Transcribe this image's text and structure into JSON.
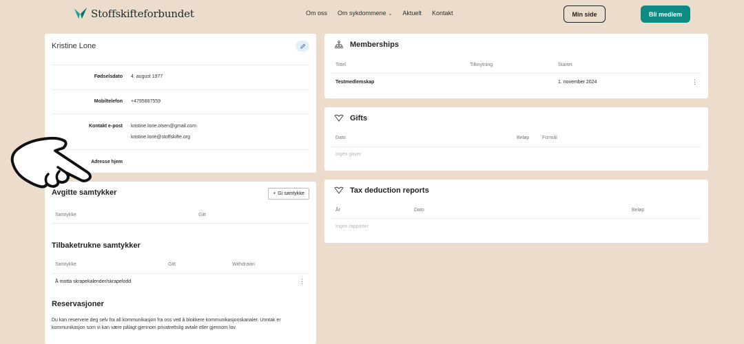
{
  "header": {
    "logo_text": "Stoffskifteforbundet",
    "nav": [
      "Om oss",
      "Om sykdommene",
      "Aktuelt",
      "Kontakt"
    ],
    "min_side": "Min side",
    "bli_medlem": "Bli medlem",
    "accent": "#0f8a82"
  },
  "profile": {
    "name": "Kristine Lone",
    "fields": {
      "birth_label": "Fødselsdato",
      "birth_value": "4. august 1977",
      "phone_label": "Mobiltelefon",
      "phone_value": "+4795887559",
      "email_label": "Kontakt e-post",
      "email_value_1": "kristine.lone.olsen@gmail.com",
      "email_value_2": "kristine.lone@stoffskifte.org",
      "address_label": "Adresse hjem"
    }
  },
  "consents": {
    "given_title": "Avgitte samtykker",
    "give_button": "Gi samtykke",
    "given_cols": [
      "Samtykke",
      "Gitt"
    ],
    "withdrawn_title": "Tilbaketrukne samtykker",
    "withdrawn_cols": [
      "Samtykke",
      "Gitt",
      "Withdrawn"
    ],
    "withdrawn_row": "Å motta skrapekalender/skrapelodd",
    "reservations_title": "Reservasjoner",
    "reservations_text": "Du kan reservere deg selv fra all kommunikasjon fra oss ved å blokkere kommunikasjonskanaler. Unntak er kommunikasjon som vi kan være pålagt gjennom privatrettslig avtale eller gjennom lov."
  },
  "memberships": {
    "title": "Memberships",
    "cols": [
      "Tittel",
      "Tilknytning",
      "Startet"
    ],
    "row_title": "Testmedlemskap",
    "row_start": "1. november 2024"
  },
  "gifts": {
    "title": "Gifts",
    "cols": [
      "Dato",
      "Beløp",
      "Formål"
    ],
    "empty": "Ingen gaver"
  },
  "tax": {
    "title": "Tax deduction reports",
    "cols": [
      "År",
      "Dato",
      "Beløp"
    ],
    "empty": "Ingen rapporter"
  }
}
